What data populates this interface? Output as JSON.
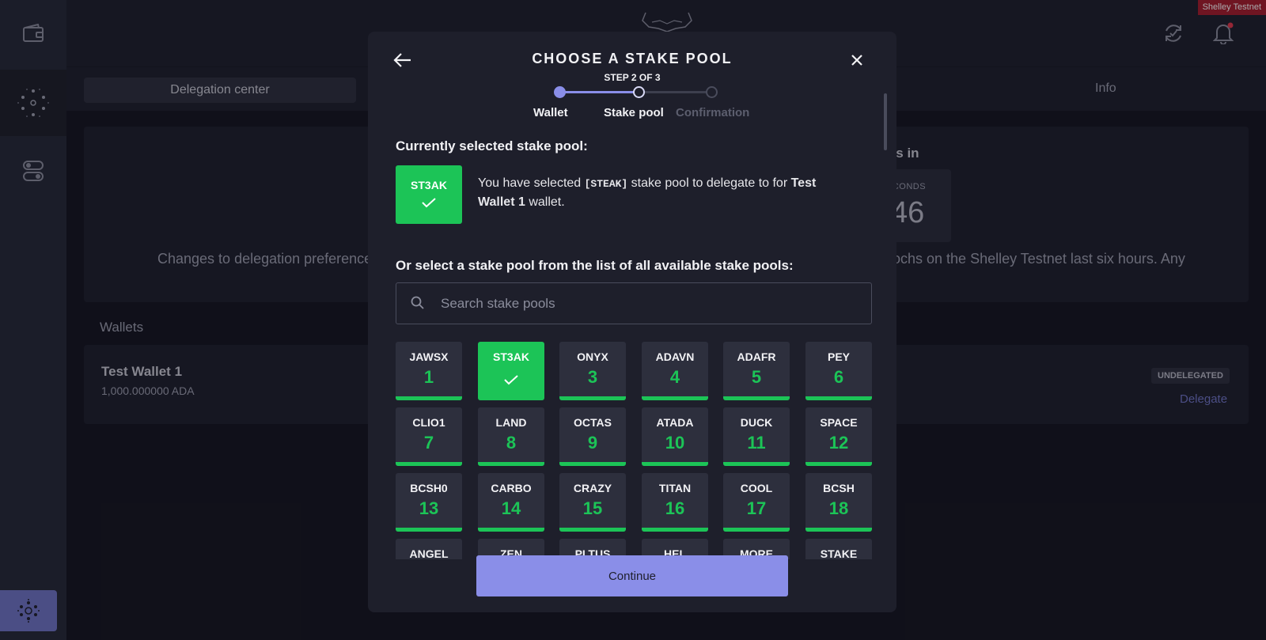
{
  "topbar": {
    "network_badge": "Shelley Testnet"
  },
  "nav": {
    "active_tab": "Delegation center",
    "info_tab": "Info"
  },
  "background": {
    "notice_left": "Changes to delegation preference",
    "notice_right": "ochs on the Shelley Testnet last six hours. Any",
    "epoch_heading": "rts in",
    "counter_label": "ECONDS",
    "counter_value": "46",
    "wallets_title": "Wallets",
    "wallet_name": "Test Wallet 1",
    "wallet_amount": "1,000.000000 ADA",
    "status_badge": "UNDELEGATED",
    "delegate_link": "Delegate"
  },
  "modal": {
    "title": "CHOOSE A STAKE POOL",
    "step_text": "STEP 2 OF 3",
    "steps": [
      "Wallet",
      "Stake pool",
      "Confirmation"
    ],
    "current_step_index": 1,
    "current_label": "Currently selected stake pool:",
    "current_pool_ticker": "ST3AK",
    "current_text_1": "You have selected ",
    "current_text_ticker": "[STEAK]",
    "current_text_2": " stake pool to delegate to for ",
    "current_text_wallet": "Test Wallet 1",
    "current_text_3": " wallet.",
    "list_label": "Or select a stake pool from the list of all available stake pools:",
    "search_placeholder": "Search stake pools",
    "continue_label": "Continue",
    "pools": [
      {
        "ticker": "JAWSX",
        "rank": "1"
      },
      {
        "ticker": "ST3AK",
        "rank": "2",
        "selected": true
      },
      {
        "ticker": "ONYX",
        "rank": "3"
      },
      {
        "ticker": "ADAVN",
        "rank": "4"
      },
      {
        "ticker": "ADAFR",
        "rank": "5"
      },
      {
        "ticker": "PEY",
        "rank": "6"
      },
      {
        "ticker": "CLIO1",
        "rank": "7"
      },
      {
        "ticker": "LAND",
        "rank": "8"
      },
      {
        "ticker": "OCTAS",
        "rank": "9"
      },
      {
        "ticker": "ATADA",
        "rank": "10"
      },
      {
        "ticker": "DUCK",
        "rank": "11"
      },
      {
        "ticker": "SPACE",
        "rank": "12"
      },
      {
        "ticker": "BCSH0",
        "rank": "13"
      },
      {
        "ticker": "CARBO",
        "rank": "14"
      },
      {
        "ticker": "CRAZY",
        "rank": "15"
      },
      {
        "ticker": "TITAN",
        "rank": "16"
      },
      {
        "ticker": "COOL",
        "rank": "17"
      },
      {
        "ticker": "BCSH",
        "rank": "18"
      },
      {
        "ticker": "ANGEL",
        "rank": ""
      },
      {
        "ticker": "ZEN",
        "rank": ""
      },
      {
        "ticker": "PLTUS",
        "rank": ""
      },
      {
        "ticker": "HEL",
        "rank": ""
      },
      {
        "ticker": "MORE",
        "rank": ""
      },
      {
        "ticker": "STAKE",
        "rank": ""
      }
    ]
  },
  "colors": {
    "accent": "#8a8ee8",
    "green": "#1cc457",
    "badge_red": "#a61c2b"
  },
  "icons": [
    "wallet-icon",
    "stake-pools-icon",
    "settings-toggle-icon",
    "cardano-icon",
    "sync-icon",
    "bell-icon",
    "back-arrow-icon",
    "close-icon",
    "search-icon",
    "checkmark-icon"
  ]
}
